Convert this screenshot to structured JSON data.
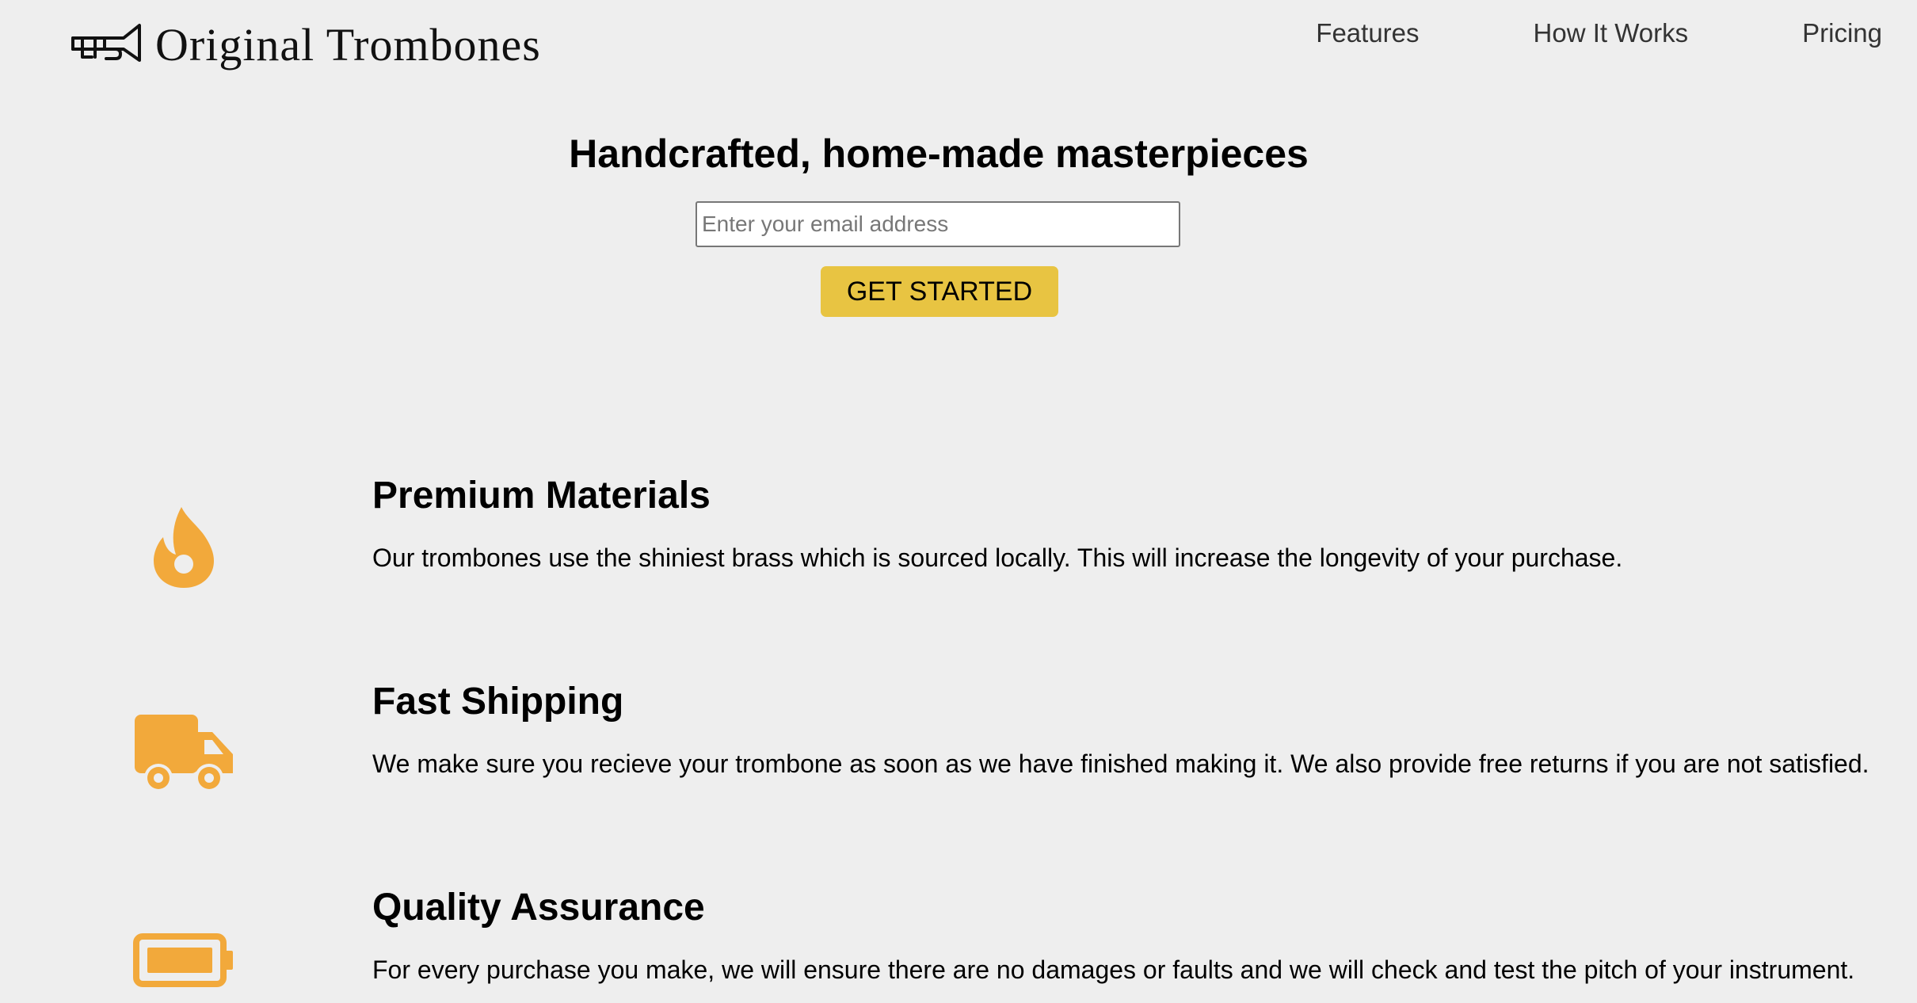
{
  "header": {
    "brand": "Original Trombones",
    "logo_icon": "trombone-logo-icon",
    "nav": [
      {
        "label": "Features"
      },
      {
        "label": "How It Works"
      },
      {
        "label": "Pricing"
      }
    ]
  },
  "hero": {
    "title": "Handcrafted, home-made masterpieces",
    "email_placeholder": "Enter your email address",
    "email_value": "",
    "cta_label": "GET STARTED"
  },
  "features": [
    {
      "icon": "flame-icon",
      "title": "Premium Materials",
      "description": "Our trombones use the shiniest brass which is sourced locally. This will increase the longevity of your purchase."
    },
    {
      "icon": "truck-icon",
      "title": "Fast Shipping",
      "description": "We make sure you recieve your trombone as soon as we have finished making it. We also provide free returns if you are not satisfied."
    },
    {
      "icon": "battery-full-icon",
      "title": "Quality Assurance",
      "description": "For every purchase you make, we will ensure there are no damages or faults and we will check and test the pitch of your instrument."
    }
  ],
  "colors": {
    "background": "#eeeeee",
    "accent_button": "#e8c442",
    "icon_orange": "#f2a93b",
    "nav_text": "#333333"
  }
}
